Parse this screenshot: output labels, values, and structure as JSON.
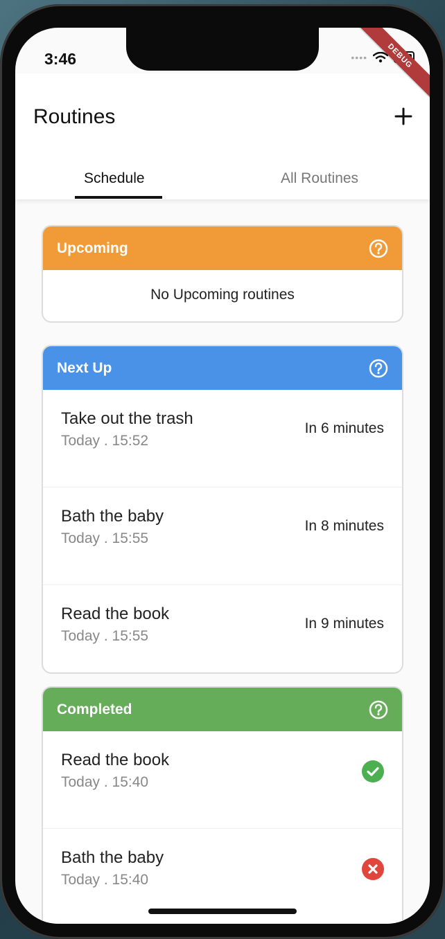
{
  "status_bar": {
    "time": "3:46",
    "debug_label": "DEBUG"
  },
  "app_bar": {
    "title": "Routines",
    "add_icon": "plus-icon"
  },
  "tabs": [
    {
      "label": "Schedule",
      "active": true
    },
    {
      "label": "All Routines",
      "active": false
    }
  ],
  "sections": {
    "upcoming": {
      "title": "Upcoming",
      "color": "#f19b38",
      "empty_text": "No Upcoming routines"
    },
    "next_up": {
      "title": "Next Up",
      "color": "#4a92e8",
      "items": [
        {
          "title": "Take out the trash",
          "time": "Today . 15:52",
          "eta": "In 6 minutes"
        },
        {
          "title": "Bath the baby",
          "time": "Today . 15:55",
          "eta": "In 8 minutes"
        },
        {
          "title": "Read the book",
          "time": "Today . 15:55",
          "eta": "In 9 minutes"
        }
      ]
    },
    "completed": {
      "title": "Completed",
      "color": "#66ad5a",
      "items": [
        {
          "title": "Read the book",
          "time": "Today . 15:40",
          "status": "done",
          "status_icon": "check-circle-icon",
          "status_color": "#4caf50"
        },
        {
          "title": "Bath the baby",
          "time": "Today . 15:40",
          "status": "missed",
          "status_icon": "x-circle-icon",
          "status_color": "#e0463c"
        }
      ]
    }
  }
}
